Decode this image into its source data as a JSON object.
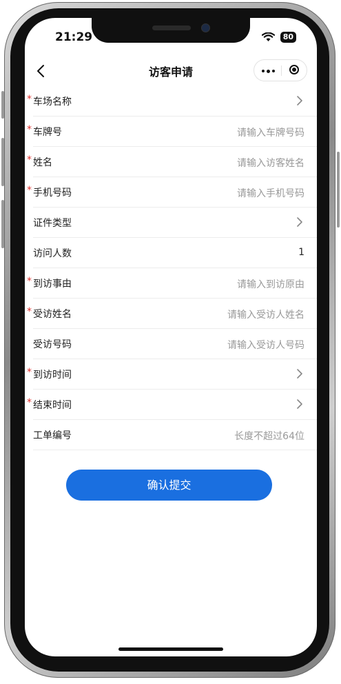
{
  "status": {
    "time": "21:29",
    "battery": "80"
  },
  "nav": {
    "title": "访客申请"
  },
  "form": {
    "rows": [
      {
        "label": "车场名称",
        "required": "*",
        "value": ""
      },
      {
        "label": "车牌号",
        "required": "*",
        "value": "请输入车牌号码"
      },
      {
        "label": "姓名",
        "required": "*",
        "value": "请输入访客姓名"
      },
      {
        "label": "手机号码",
        "required": "*",
        "value": "请输入手机号码"
      },
      {
        "label": "证件类型",
        "required": "",
        "value": ""
      },
      {
        "label": "访问人数",
        "required": "",
        "value": "1"
      },
      {
        "label": "到访事由",
        "required": "*",
        "value": "请输入到访原由"
      },
      {
        "label": "受访姓名",
        "required": "*",
        "value": "请输入受访人姓名"
      },
      {
        "label": "受访号码",
        "required": "",
        "value": "请输入受访人号码"
      },
      {
        "label": "到访时间",
        "required": "*",
        "value": ""
      },
      {
        "label": "结束时间",
        "required": "*",
        "value": ""
      },
      {
        "label": "工单编号",
        "required": "",
        "value": "长度不超过64位"
      }
    ]
  },
  "submit": {
    "label": "确认提交"
  },
  "colors": {
    "accent": "#1a6fe0",
    "required": "#e0322f"
  }
}
